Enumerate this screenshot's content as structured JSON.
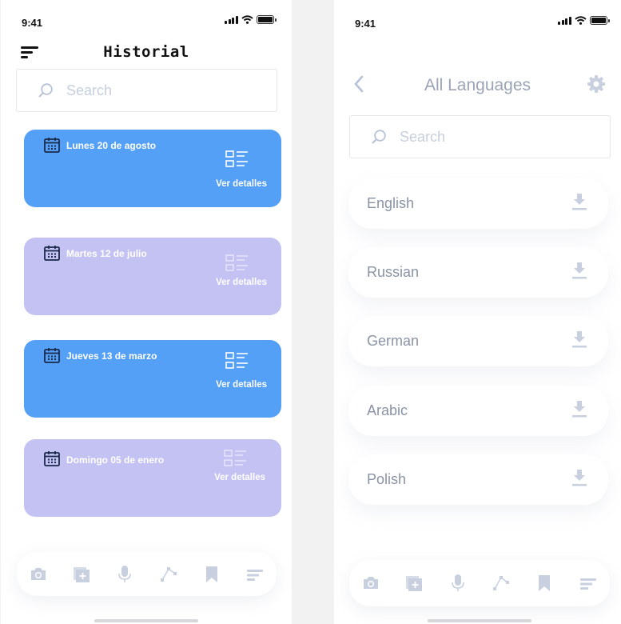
{
  "left_screen": {
    "status_time": "9:41",
    "title": "Historial",
    "search_placeholder": "Search",
    "cards": [
      {
        "date": "Lunes 20 de agosto",
        "action": "Ver detalles",
        "color": "#54a0f7"
      },
      {
        "date": "Martes 12 de julio",
        "action": "Ver detalles",
        "color": "#c3c2f3"
      },
      {
        "date": "Jueves 13 de marzo",
        "action": "Ver detalles",
        "color": "#54a0f7"
      },
      {
        "date": "Domingo 05 de enero",
        "action": "Ver detalles",
        "color": "#c3c2f3"
      }
    ],
    "tabbar_icons": [
      "camera-icon",
      "add-image-icon",
      "microphone-icon",
      "vector-pen-icon",
      "bookmark-icon",
      "text-lines-icon"
    ]
  },
  "right_screen": {
    "status_time": "9:41",
    "title": "All Languages",
    "search_placeholder": "Search",
    "languages": [
      "English",
      "Russian",
      "German",
      "Arabic",
      "Polish"
    ],
    "tabbar_icons": [
      "camera-icon",
      "add-image-icon",
      "microphone-icon",
      "vector-pen-icon",
      "bookmark-icon",
      "text-lines-icon"
    ]
  },
  "colors": {
    "blue_card": "#54a0f7",
    "purple_card": "#c3c2f3",
    "icon_muted": "#c8d0df"
  }
}
